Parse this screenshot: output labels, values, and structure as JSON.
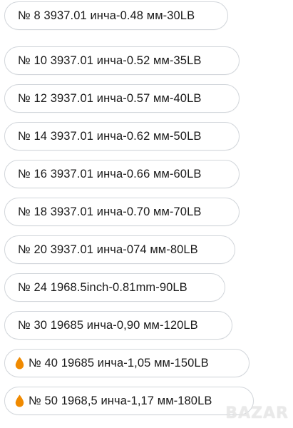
{
  "options": [
    {
      "label": "№ 8 3937.01 инча-0.48 мм-30LB",
      "icon": null
    },
    {
      "label": "№ 10 3937.01 инча-0.52 мм-35LB",
      "icon": null
    },
    {
      "label": "№ 12 3937.01 инча-0.57 мм-40LB",
      "icon": null
    },
    {
      "label": "№ 14 3937.01 инча-0.62 мм-50LB",
      "icon": null
    },
    {
      "label": "№ 16 3937.01 инча-0.66 мм-60LB",
      "icon": null
    },
    {
      "label": "№ 18 3937.01 инча-0.70 мм-70LB",
      "icon": null
    },
    {
      "label": "№ 20 3937.01 инча-074 мм-80LB",
      "icon": null
    },
    {
      "label": "№ 24 1968.5inch-0.81mm-90LB",
      "icon": null
    },
    {
      "label": "№ 30 19685 инча-0,90 мм-120LB",
      "icon": null
    },
    {
      "label": "№ 40 19685 инча-1,05 мм-150LB",
      "icon": "fire-drop-icon"
    },
    {
      "label": "№ 50 1968,5 инча-1,17 мм-180LB",
      "icon": "fire-drop-icon"
    }
  ],
  "colors": {
    "border": "#d2d6db",
    "text": "#1a1a1a",
    "accent": "#f08a00"
  },
  "watermark": "BAZAR"
}
